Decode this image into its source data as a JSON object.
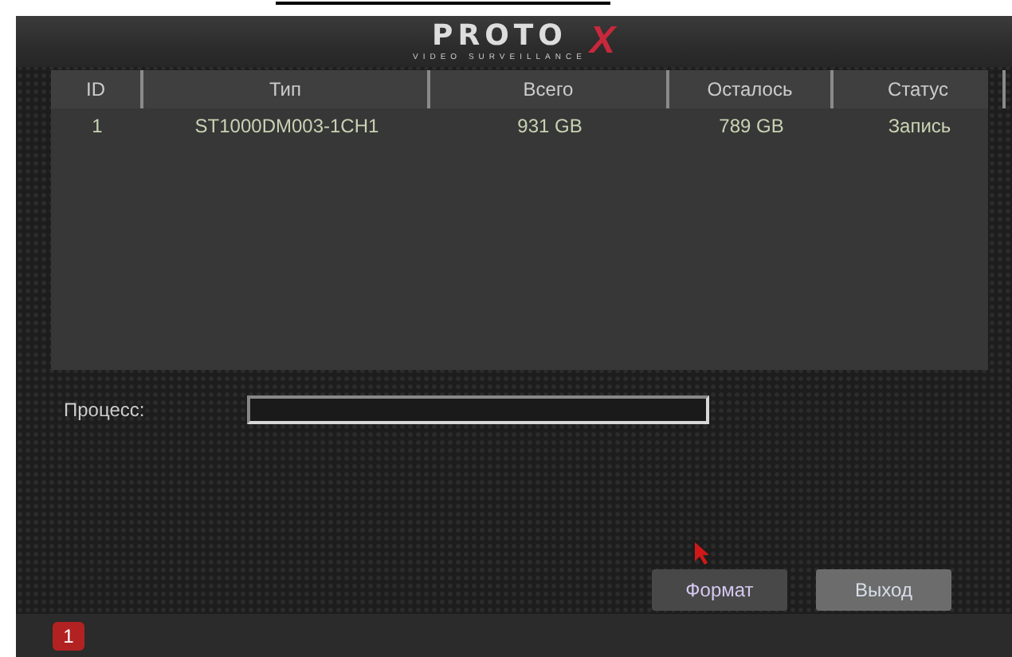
{
  "logo": {
    "name": "PROTO",
    "mark": "X",
    "tagline": "VIDEO SURVEILLANCE"
  },
  "table": {
    "columns": [
      "ID",
      "Тип",
      "Всего",
      "Осталось",
      "Статус"
    ],
    "rows": [
      {
        "cells": [
          "1",
          "ST1000DM003-1CH1",
          "931 GB",
          "789 GB",
          "Запись"
        ]
      }
    ]
  },
  "process": {
    "label": "Процесс:",
    "level": 0
  },
  "buttons": [
    {
      "label": "Формат",
      "selected": false
    },
    {
      "label": "Выход",
      "selected": true
    }
  ],
  "status_bar": {
    "badge": "1"
  }
}
